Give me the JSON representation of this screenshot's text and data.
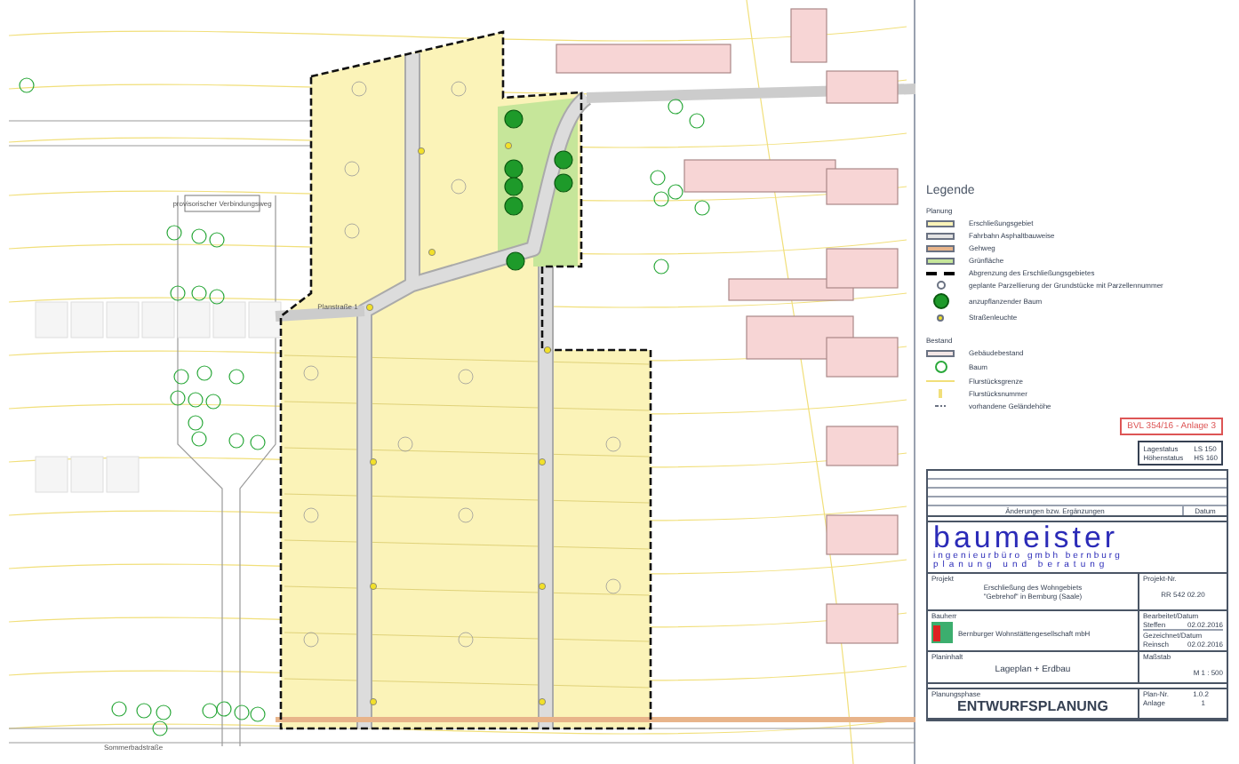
{
  "map": {
    "labels": [
      {
        "kind": "box",
        "text": "provisorischer Verbindungsweg"
      },
      {
        "kind": "street",
        "text": "Planstraße 1"
      },
      {
        "kind": "street-bottom",
        "text": "Sommerbadstraße"
      }
    ]
  },
  "legend": {
    "title": "Legende",
    "sections": [
      {
        "heading": "Planung",
        "items": [
          {
            "kind": "fill",
            "color": "#fbf3b8",
            "label": "Erschließungsgebiet"
          },
          {
            "kind": "fill",
            "color": "#e4e4e4",
            "label": "Fahrbahn Asphaltbauweise"
          },
          {
            "kind": "fill",
            "color": "#e8b48a",
            "label": "Gehweg"
          },
          {
            "kind": "fill",
            "color": "#c6e69a",
            "label": "Grünfläche"
          },
          {
            "kind": "dashed",
            "label": "Abgrenzung des Erschließungsgebietes"
          },
          {
            "kind": "parcel",
            "label": "geplante Parzellierung der Grundstücke mit Parzellennummer"
          },
          {
            "kind": "new-tree",
            "label": "anzupflanzender Baum"
          },
          {
            "kind": "lamp",
            "label": "Straßenleuchte"
          }
        ]
      },
      {
        "heading": "Bestand",
        "items": [
          {
            "kind": "building",
            "label": "Gebäudebestand"
          },
          {
            "kind": "tree",
            "label": "Baum"
          },
          {
            "kind": "boundary",
            "label": "Flurstücksgrenze"
          },
          {
            "kind": "parcel-no",
            "label": "Flurstücksnummer"
          },
          {
            "kind": "elevation",
            "label": "vorhandene Geländehöhe"
          }
        ]
      }
    ]
  },
  "stamp": "BVL 354/16 - Anlage 3",
  "status": [
    {
      "label": "Lagestatus",
      "value": "LS 150"
    },
    {
      "label": "Höhenstatus",
      "value": "HS 160"
    }
  ],
  "revisions": {
    "columns": [
      "Änderungen bzw. Ergänzungen",
      "Datum"
    ]
  },
  "company": {
    "name": "baumeister",
    "line1": "ingenieurbüro gmbh bernburg",
    "line2": "planung und beratung"
  },
  "project": {
    "label": "Projekt",
    "lines": [
      "Erschließung des Wohngebiets",
      "\"Gebrehof\" in Bernburg (Saale)"
    ],
    "number_label": "Projekt-Nr.",
    "number": "RR 542 02.20"
  },
  "client": {
    "label": "Bauherr",
    "name": "Bernburger Wohnstättengesellschaft mbH",
    "edited_label": "Bearbeitet/Datum",
    "edited_by": "Steffen",
    "edited_date": "02.02.2016",
    "drawn_label": "Gezeichnet/Datum",
    "drawn_by": "Reinsch",
    "drawn_date": "02.02.2016"
  },
  "content": {
    "label": "Planinhalt",
    "value": "Lageplan + Erdbau",
    "scale_label": "Maßstab",
    "scale": "M 1 : 500"
  },
  "phase": {
    "label": "Planungsphase",
    "value": "ENTWURFSPLANUNG",
    "sheet_label": "Plan-Nr.",
    "sheet": "1.0.2",
    "annex_label": "Anlage",
    "annex": "1"
  }
}
